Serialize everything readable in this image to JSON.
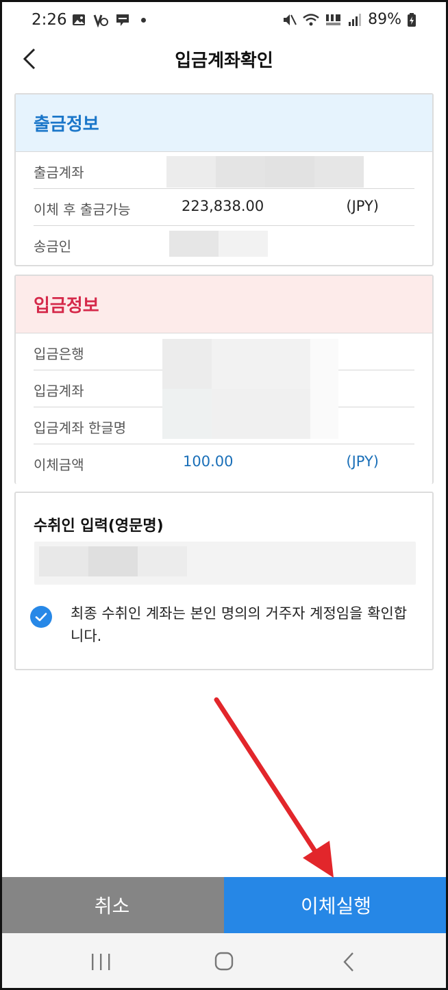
{
  "status_bar": {
    "time": "2:26",
    "battery": "89%"
  },
  "header": {
    "title": "입금계좌확인"
  },
  "withdraw": {
    "title": "출금정보",
    "rows": [
      {
        "label": "출금계좌"
      },
      {
        "label": "이체 후 출금가능",
        "value": "223,838.00",
        "unit": "(JPY)"
      },
      {
        "label": "송금인"
      }
    ]
  },
  "deposit": {
    "title": "입금정보",
    "rows": [
      {
        "label": "입금은행"
      },
      {
        "label": "입금계좌"
      },
      {
        "label": "입금계좌 한글명"
      },
      {
        "label": "이체금액",
        "value": "100.00",
        "unit": "(JPY)"
      }
    ]
  },
  "recipient": {
    "title": "수취인 입력(영문명)",
    "confirm_checked": true,
    "confirm_text": "최종 수취인 계좌는 본인 명의의 거주자 계정임을 확인합니다."
  },
  "buttons": {
    "cancel": "취소",
    "execute": "이체실행"
  },
  "colors": {
    "primary": "#2687e6",
    "withdraw_header_bg": "#e6f3fd",
    "withdraw_title": "#1a76c9",
    "deposit_header_bg": "#fdebea",
    "deposit_title": "#d5294a",
    "cancel_bg": "#858585",
    "annotation_arrow": "#e2262b"
  }
}
